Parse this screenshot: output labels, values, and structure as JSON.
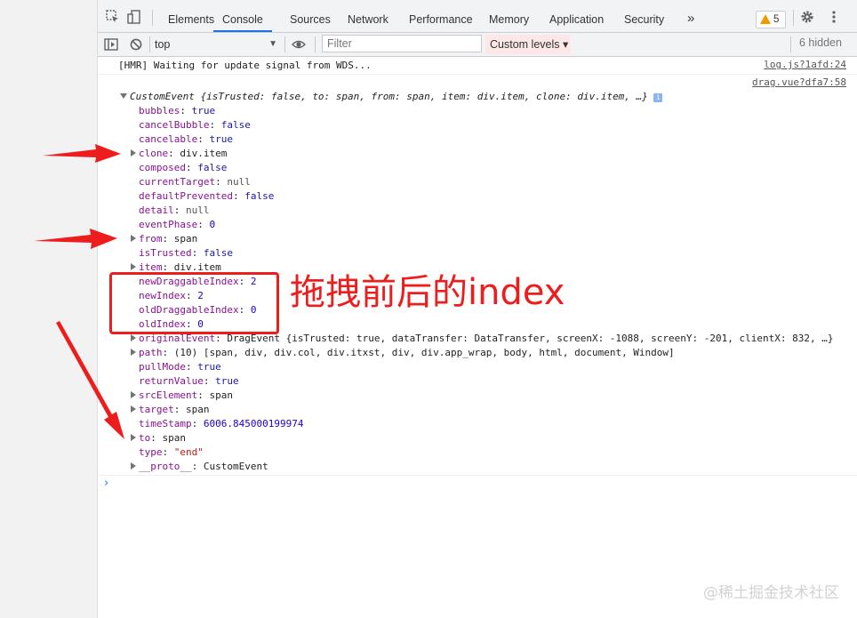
{
  "tabs": [
    "Elements",
    "Console",
    "Sources",
    "Network",
    "Performance",
    "Memory",
    "Application",
    "Security"
  ],
  "active_tab": "Console",
  "more_tabs_glyph": "»",
  "warning_count": "5",
  "toolbar": {
    "context": "top",
    "filter_placeholder": "Filter",
    "levels": "Custom levels ▾",
    "hidden": "6 hidden"
  },
  "log": [
    {
      "text": "[HMR] Waiting for update signal from WDS...",
      "source": "log.js?1afd:24"
    },
    {
      "text": "",
      "source": "drag.vue?dfa7:58"
    }
  ],
  "event_header": {
    "name": "CustomEvent",
    "preview": "{isTrusted: false, to: span, from: span, item: div.item, clone: div.item, …}",
    "info": "i"
  },
  "props": [
    {
      "key": "bubbles",
      "value": "true",
      "type": "b",
      "expandable": false
    },
    {
      "key": "cancelBubble",
      "value": "false",
      "type": "b",
      "expandable": false
    },
    {
      "key": "cancelable",
      "value": "true",
      "type": "b",
      "expandable": false
    },
    {
      "key": "clone",
      "value": "div.item",
      "type": "o",
      "expandable": true
    },
    {
      "key": "composed",
      "value": "false",
      "type": "b",
      "expandable": false
    },
    {
      "key": "currentTarget",
      "value": "null",
      "type": "null",
      "expandable": false
    },
    {
      "key": "defaultPrevented",
      "value": "false",
      "type": "b",
      "expandable": false
    },
    {
      "key": "detail",
      "value": "null",
      "type": "null",
      "expandable": false
    },
    {
      "key": "eventPhase",
      "value": "0",
      "type": "n",
      "expandable": false
    },
    {
      "key": "from",
      "value": "span",
      "type": "o",
      "expandable": true
    },
    {
      "key": "isTrusted",
      "value": "false",
      "type": "b",
      "expandable": false
    },
    {
      "key": "item",
      "value": "div.item",
      "type": "o",
      "expandable": true
    },
    {
      "key": "newDraggableIndex",
      "value": "2",
      "type": "n",
      "expandable": false
    },
    {
      "key": "newIndex",
      "value": "2",
      "type": "n",
      "expandable": false
    },
    {
      "key": "oldDraggableIndex",
      "value": "0",
      "type": "n",
      "expandable": false
    },
    {
      "key": "oldIndex",
      "value": "0",
      "type": "n",
      "expandable": false
    },
    {
      "key": "originalEvent",
      "value": "DragEvent {isTrusted: true, dataTransfer: DataTransfer, screenX: -1088, screenY: -201, clientX: 832, …}",
      "type": "o",
      "expandable": true
    },
    {
      "key": "path",
      "value": "(10) [span, div, div.col, div.itxst, div, div.app_wrap, body, html, document, Window]",
      "type": "o",
      "expandable": true
    },
    {
      "key": "pullMode",
      "value": "true",
      "type": "b",
      "expandable": false
    },
    {
      "key": "returnValue",
      "value": "true",
      "type": "b",
      "expandable": false
    },
    {
      "key": "srcElement",
      "value": "span",
      "type": "o",
      "expandable": true
    },
    {
      "key": "target",
      "value": "span",
      "type": "o",
      "expandable": true
    },
    {
      "key": "timeStamp",
      "value": "6006.845000199974",
      "type": "n",
      "expandable": false
    },
    {
      "key": "to",
      "value": "span",
      "type": "o",
      "expandable": true
    },
    {
      "key": "type",
      "value": "\"end\"",
      "type": "s",
      "expandable": false
    },
    {
      "key": "__proto__",
      "value": "CustomEvent",
      "type": "o",
      "expandable": true
    }
  ],
  "prompt": "›",
  "annotation": "拖拽前后的index",
  "watermark": "@稀土掘金技术社区"
}
